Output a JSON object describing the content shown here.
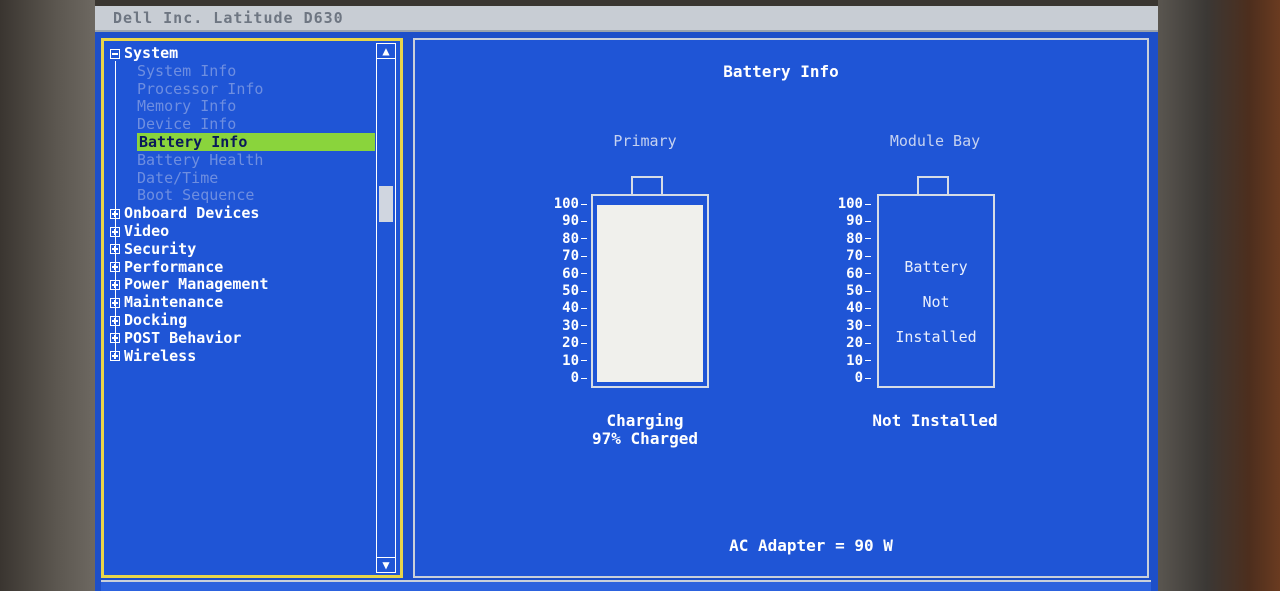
{
  "window": {
    "title": "Dell Inc. Latitude D630"
  },
  "tree": {
    "root": {
      "label": "System",
      "expanded": true
    },
    "children": [
      {
        "label": "System Info",
        "selected": false
      },
      {
        "label": "Processor Info",
        "selected": false
      },
      {
        "label": "Memory Info",
        "selected": false
      },
      {
        "label": "Device Info",
        "selected": false
      },
      {
        "label": "Battery Info",
        "selected": true
      },
      {
        "label": "Battery Health",
        "selected": false
      },
      {
        "label": "Date/Time",
        "selected": false
      },
      {
        "label": "Boot Sequence",
        "selected": false
      }
    ],
    "groups": [
      {
        "label": "Onboard Devices"
      },
      {
        "label": "Video"
      },
      {
        "label": "Security"
      },
      {
        "label": "Performance"
      },
      {
        "label": "Power Management"
      },
      {
        "label": "Maintenance"
      },
      {
        "label": "Docking"
      },
      {
        "label": "POST Behavior"
      },
      {
        "label": "Wireless"
      }
    ]
  },
  "panel": {
    "title": "Battery Info",
    "scale": [
      "100",
      "90",
      "80",
      "70",
      "60",
      "50",
      "40",
      "30",
      "20",
      "10",
      "0"
    ],
    "primary": {
      "label": "Primary",
      "charge_level": 97,
      "status": "Charging",
      "charge_text": "97% Charged"
    },
    "module_bay": {
      "label": "Module Bay",
      "message_lines": [
        "Battery",
        "Not",
        "Installed"
      ],
      "status": "Not Installed"
    },
    "ac_adapter": "AC Adapter = 90 W"
  },
  "colors": {
    "screen": "#1d4fc9",
    "selection": "#8ad43c",
    "focus_border": "#e8d54a"
  }
}
